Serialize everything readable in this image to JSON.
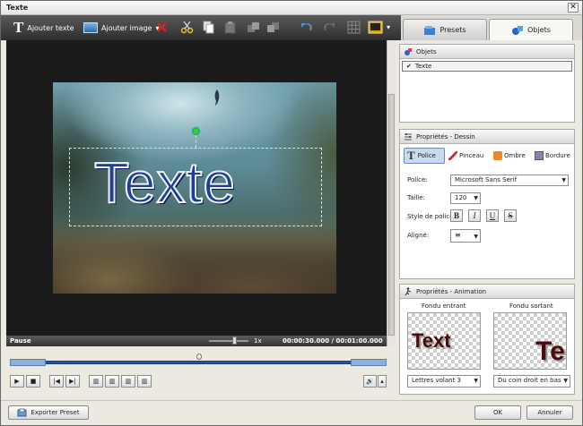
{
  "window": {
    "title": "Texte",
    "close_glyph": "✕"
  },
  "toolbar": {
    "add_text": "Ajouter texte",
    "add_image": "Ajouter image",
    "add_text_glyph": "T",
    "dropdown_glyph": "▾",
    "icons": [
      "text-icon",
      "image-icon",
      "delete-icon",
      "cut-icon",
      "copy-icon",
      "paste-icon",
      "layer-down-icon",
      "layer-up-icon",
      "undo-icon",
      "redo-icon",
      "grid-icon",
      "screen-icon"
    ]
  },
  "tabs": [
    {
      "label": "Presets"
    },
    {
      "label": "Objets"
    }
  ],
  "preview": {
    "overlay_text": "Texte"
  },
  "status": {
    "state": "Pause",
    "speed": "1x",
    "time": "00:00:30.000  /  00:01:00.000"
  },
  "objects_panel": {
    "title": "Objets",
    "items": [
      {
        "label": "Texte",
        "checked": true,
        "check_glyph": "✔"
      }
    ]
  },
  "drawing_panel": {
    "title": "Propriétés - Dessin",
    "tabs": [
      {
        "label": "Police"
      },
      {
        "label": "Pinceau"
      },
      {
        "label": "Ombre"
      },
      {
        "label": "Bordure"
      }
    ],
    "font_label": "Police:",
    "font_value": "Microsoft Sans Serif",
    "size_label": "Taille:",
    "size_value": "120",
    "style_label": "Style de police",
    "style_buttons": [
      "B",
      "I",
      "U",
      "S"
    ],
    "align_label": "Aligné:",
    "align_glyph": "≡"
  },
  "animation_panel": {
    "title": "Propriétés - Animation",
    "in_label": "Fondu entrant",
    "out_label": "Fondu sortant",
    "in_preview_text": "Text",
    "out_preview_text": "Te",
    "in_value": "Lettres volant 3",
    "out_value": "Du coin droit en bas"
  },
  "footer": {
    "export_preset": "Exporter Preset",
    "ok": "OK",
    "cancel": "Annuler"
  },
  "colors": {
    "accent_text": "#1c3f9e",
    "toolbar_bg": "#3a3a3a",
    "handle": "#2ecc40"
  }
}
